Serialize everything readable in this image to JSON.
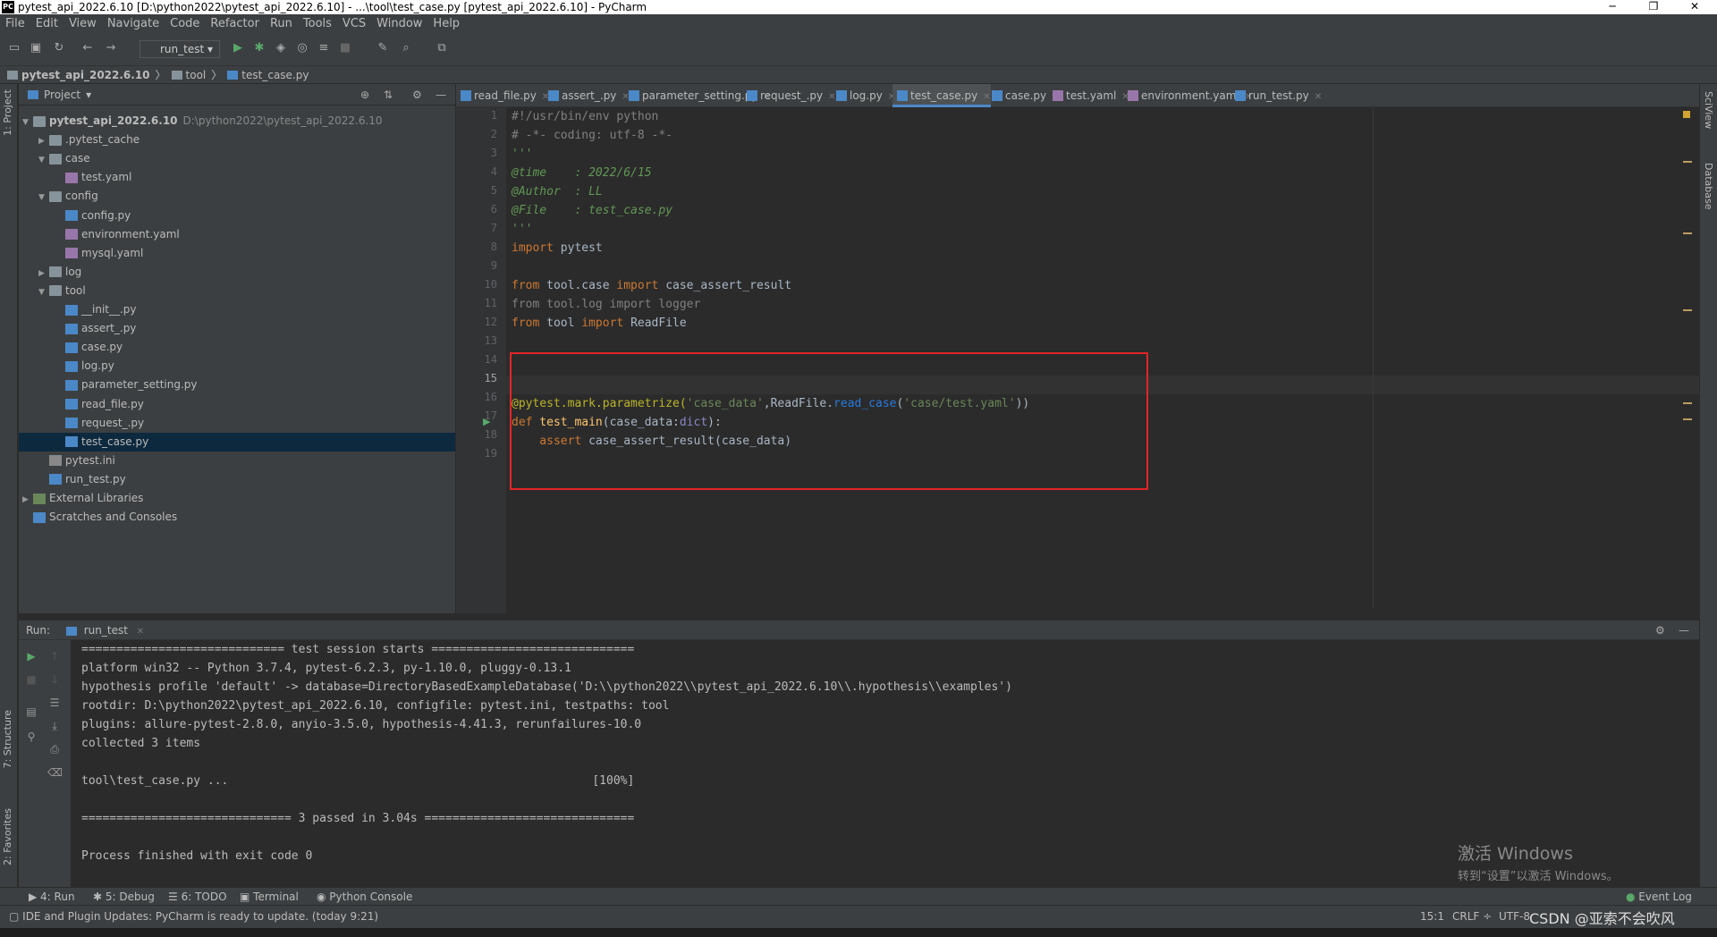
{
  "window": {
    "title": "pytest_api_2022.6.10 [D:\\python2022\\pytest_api_2022.6.10] - ...\\tool\\test_case.py [pytest_api_2022.6.10] - PyCharm",
    "logo": "PC",
    "minimize": "─",
    "restore": "❐",
    "close": "✕"
  },
  "menu": [
    "File",
    "Edit",
    "View",
    "Navigate",
    "Code",
    "Refactor",
    "Run",
    "Tools",
    "VCS",
    "Window",
    "Help"
  ],
  "toolbar": {
    "run_config": "run_test"
  },
  "breadcrumb": [
    "pytest_api_2022.6.10",
    "tool",
    "test_case.py"
  ],
  "left_strip": {
    "project": "1: Project",
    "structure": "7: Structure",
    "favorites": "2: Favorites"
  },
  "right_strip": {
    "sciview": "SciView",
    "database": "Database"
  },
  "project_panel": {
    "title": "Project",
    "tree": [
      {
        "label": "pytest_api_2022.6.10",
        "path": "D:\\python2022\\pytest_api_2022.6.10",
        "arrow": "▼",
        "icon": "folder-icon"
      },
      {
        "label": ".pytest_cache",
        "arrow": "▶",
        "icon": "folder-icon"
      },
      {
        "label": "case",
        "arrow": "▼",
        "icon": "folder-icon"
      },
      {
        "label": "test.yaml",
        "arrow": "",
        "icon": "yaml-file-icon"
      },
      {
        "label": "config",
        "arrow": "▼",
        "icon": "folder-icon"
      },
      {
        "label": "config.py",
        "arrow": "",
        "icon": "python-file-icon"
      },
      {
        "label": "environment.yaml",
        "arrow": "",
        "icon": "yaml-file-icon"
      },
      {
        "label": "mysql.yaml",
        "arrow": "",
        "icon": "yaml-file-icon"
      },
      {
        "label": "log",
        "arrow": "▶",
        "icon": "folder-icon"
      },
      {
        "label": "tool",
        "arrow": "▼",
        "icon": "folder-icon"
      },
      {
        "label": "__init__.py",
        "arrow": "",
        "icon": "python-file-icon"
      },
      {
        "label": "assert_.py",
        "arrow": "",
        "icon": "python-file-icon"
      },
      {
        "label": "case.py",
        "arrow": "",
        "icon": "python-file-icon"
      },
      {
        "label": "log.py",
        "arrow": "",
        "icon": "python-file-icon"
      },
      {
        "label": "parameter_setting.py",
        "arrow": "",
        "icon": "python-file-icon"
      },
      {
        "label": "read_file.py",
        "arrow": "",
        "icon": "python-file-icon"
      },
      {
        "label": "request_.py",
        "arrow": "",
        "icon": "python-file-icon"
      },
      {
        "label": "test_case.py",
        "arrow": "",
        "icon": "python-file-icon",
        "selected": true
      },
      {
        "label": "pytest.ini",
        "arrow": "",
        "icon": "ini-file-icon"
      },
      {
        "label": "run_test.py",
        "arrow": "",
        "icon": "python-file-icon"
      },
      {
        "label": "External Libraries",
        "arrow": "▶",
        "icon": "library-icon"
      },
      {
        "label": "Scratches and Consoles",
        "arrow": "",
        "icon": "scratches-icon"
      }
    ]
  },
  "editor_tabs": [
    "read_file.py",
    "assert_.py",
    "parameter_setting.py",
    "request_.py",
    "log.py",
    "test_case.py",
    "case.py",
    "test.yaml",
    "environment.yaml",
    "run_test.py"
  ],
  "active_tab": "test_case.py",
  "line_numbers": [
    "1",
    "2",
    "3",
    "4",
    "5",
    "6",
    "7",
    "8",
    "9",
    "10",
    "11",
    "12",
    "13",
    "14",
    "15",
    "16",
    "17",
    "18",
    "19"
  ],
  "code": {
    "l1": "#!/usr/bin/env python",
    "l2": "# -*- coding: utf-8 -*-",
    "l3": "'''",
    "l4": "@time    : 2022/6/15",
    "l5": "@Author  : LL",
    "l6": "@File    : test_case.py",
    "l7": "'''",
    "l8a": "import",
    "l8b": " pytest",
    "l10a": "from",
    "l10b": " tool.case ",
    "l10c": "import",
    "l10d": " case_assert_result",
    "l11": "from tool.log import logger",
    "l12a": "from",
    "l12b": " tool ",
    "l12c": "import",
    "l12d": " ReadFile",
    "l16a": "@pytest.mark.parametrize(",
    "l16b": "'case_data'",
    "l16c": ",ReadFile.",
    "l16d": "read_case",
    "l16e": "(",
    "l16f": "'case/test.yaml'",
    "l16g": "))",
    "l17a": "def",
    "l17b": " test_main",
    "l17c": "(case_data:",
    "l17d": "dict",
    "l17e": "):",
    "l18a": "    assert",
    "l18b": " case_assert_result(case_data)"
  },
  "run_panel": {
    "label": "Run:",
    "config": "run_test",
    "output": [
      "============================= test session starts =============================",
      "platform win32 -- Python 3.7.4, pytest-6.2.3, py-1.10.0, pluggy-0.13.1",
      "hypothesis profile 'default' -> database=DirectoryBasedExampleDatabase('D:\\\\python2022\\\\pytest_api_2022.6.10\\\\.hypothesis\\\\examples')",
      "rootdir: D:\\python2022\\pytest_api_2022.6.10, configfile: pytest.ini, testpaths: tool",
      "plugins: allure-pytest-2.8.0, anyio-3.5.0, hypothesis-4.41.3, rerunfailures-10.0",
      "collected 3 items",
      "",
      "tool\\test_case.py ...                                                    [100%]",
      "",
      "============================== 3 passed in 3.04s ==============================",
      "",
      "Process finished with exit code 0"
    ]
  },
  "watermark": {
    "line1": "激活 Windows",
    "line2": "转到“设置”以激活 Windows。"
  },
  "bottom_tabs": [
    "4: Run",
    "5: Debug",
    "6: TODO",
    "Terminal",
    "Python Console"
  ],
  "event_log": "Event Log",
  "status": {
    "message": "IDE and Plugin Updates: PyCharm is ready to update. (today 9:21)",
    "position": "15:1",
    "line_sep": "CRLF ÷",
    "encoding": "UTF-8",
    "csdn": "CSDN @亚索不会吹风"
  },
  "colors": {
    "accent": "#4a88c7",
    "highlight_box": "#e22525",
    "selection": "#0d293e"
  }
}
